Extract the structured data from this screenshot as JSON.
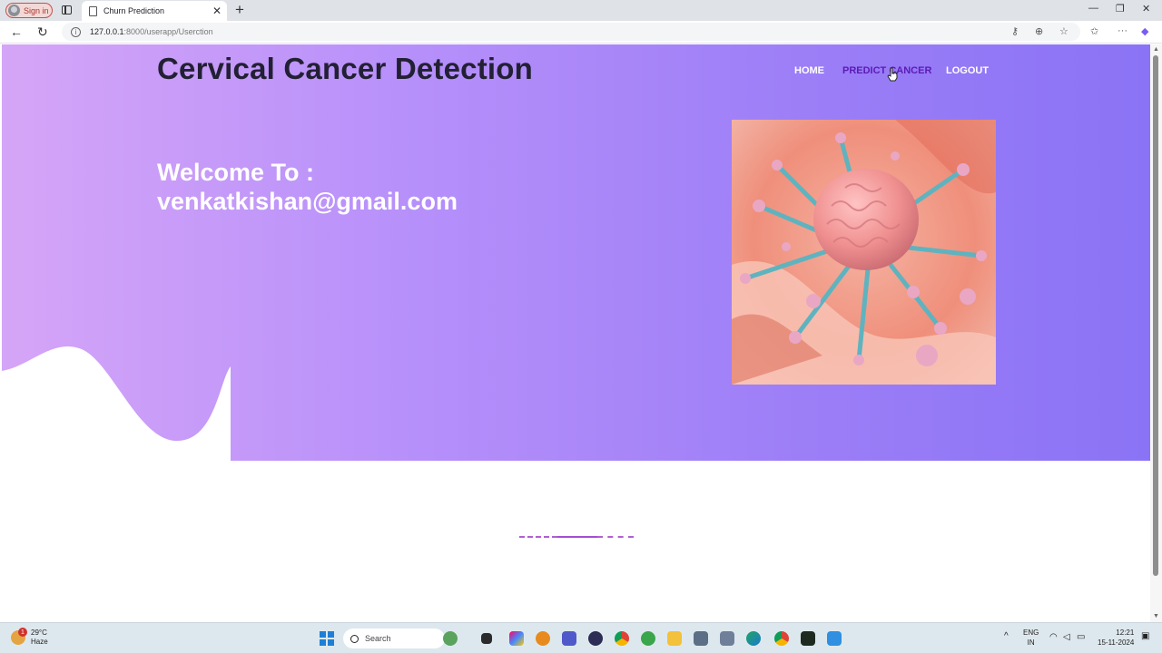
{
  "browser": {
    "signin_label": "Sign in",
    "tab_title": "Churn Prediction",
    "tab_close": "✕",
    "new_tab": "+",
    "url_host": "127.0.0.1",
    "url_path": ":8000/userapp/Userction",
    "back": "←",
    "reload": "↻",
    "minimize": "—",
    "restore": "❐",
    "close": "✕",
    "more": "···"
  },
  "page": {
    "site_title": "Cervical Cancer Detection",
    "nav": [
      {
        "label": "HOME"
      },
      {
        "label": "PREDICT CANCER"
      },
      {
        "label": "LOGOUT"
      }
    ],
    "welcome_line1": "Welcome To :",
    "welcome_line2": "venkatkishan@gmail.com"
  },
  "taskbar": {
    "temperature": "29°C",
    "weather": "Haze",
    "weather_badge": "1",
    "search_label": "Search",
    "language_line1": "ENG",
    "language_line2": "IN",
    "time": "12:21",
    "date": "15-11-2024"
  },
  "colors": {
    "hero_start": "#d5a5f7",
    "hero_end": "#8a73f5",
    "active_nav": "#5b1bb5",
    "title": "#222034"
  }
}
